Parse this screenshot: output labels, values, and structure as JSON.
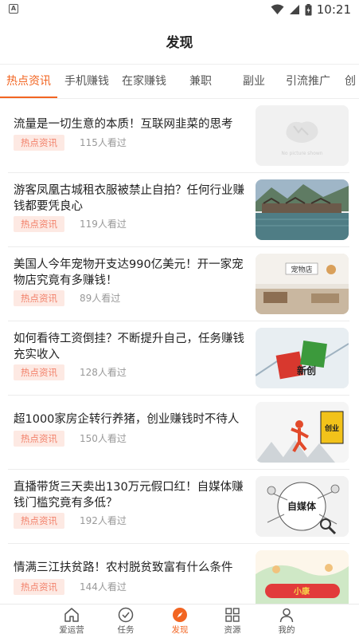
{
  "status_bar": {
    "time": "10:21"
  },
  "header": {
    "title": "发现"
  },
  "tabs": [
    {
      "label": "热点资讯",
      "active": true
    },
    {
      "label": "手机赚钱"
    },
    {
      "label": "在家赚钱"
    },
    {
      "label": "兼职"
    },
    {
      "label": "副业"
    },
    {
      "label": "引流推广"
    },
    {
      "label": "创"
    }
  ],
  "feed": [
    {
      "title": "流量是一切生意的本质！互联网韭菜的思考",
      "tag": "热点资讯",
      "views": "115人看过",
      "thumb_icon": "no-picture-placeholder",
      "thumb_caption": "No picture shown"
    },
    {
      "title": "游客凤凰古城租衣服被禁止自拍？任何行业赚钱都要凭良心",
      "tag": "热点资讯",
      "views": "119人看过",
      "thumb_icon": "ancient-town-photo"
    },
    {
      "title": "美国人今年宠物开支达990亿美元！开一家宠物店究竟有多赚钱！",
      "tag": "热点资讯",
      "views": "89人看过",
      "thumb_icon": "pet-shop-photo",
      "thumb_caption": "宠物店"
    },
    {
      "title": "如何看待工资倒挂？不断提升自己，任务赚钱充实收入",
      "tag": "热点资讯",
      "views": "128人看过",
      "thumb_icon": "innovation-dice-photo",
      "thumb_caption": "新创"
    },
    {
      "title": "超1000家房企转行养猪，创业赚钱时不待人",
      "tag": "热点资讯",
      "views": "150人看过",
      "thumb_icon": "entrepreneur-photo",
      "thumb_caption": "创业"
    },
    {
      "title": "直播带货三天卖出130万元假口红！自媒体赚钱门槛究竟有多低？",
      "tag": "热点资讯",
      "views": "192人看过",
      "thumb_icon": "self-media-photo",
      "thumb_caption": "自媒体"
    },
    {
      "title": "情满三江扶贫路！农村脱贫致富有什么条件",
      "tag": "热点资讯",
      "views": "144人看过",
      "thumb_icon": "poverty-relief-photo",
      "thumb_caption": "小康"
    }
  ],
  "bottom_nav": [
    {
      "label": "爱运营",
      "icon": "home-icon"
    },
    {
      "label": "任务",
      "icon": "check-circle-icon"
    },
    {
      "label": "发现",
      "icon": "compass-icon",
      "active": true
    },
    {
      "label": "资源",
      "icon": "grid-icon"
    },
    {
      "label": "我的",
      "icon": "person-icon"
    }
  ],
  "colors": {
    "accent": "#f26522",
    "tag_bg": "#fde9e3",
    "tag_text": "#f2816a"
  }
}
